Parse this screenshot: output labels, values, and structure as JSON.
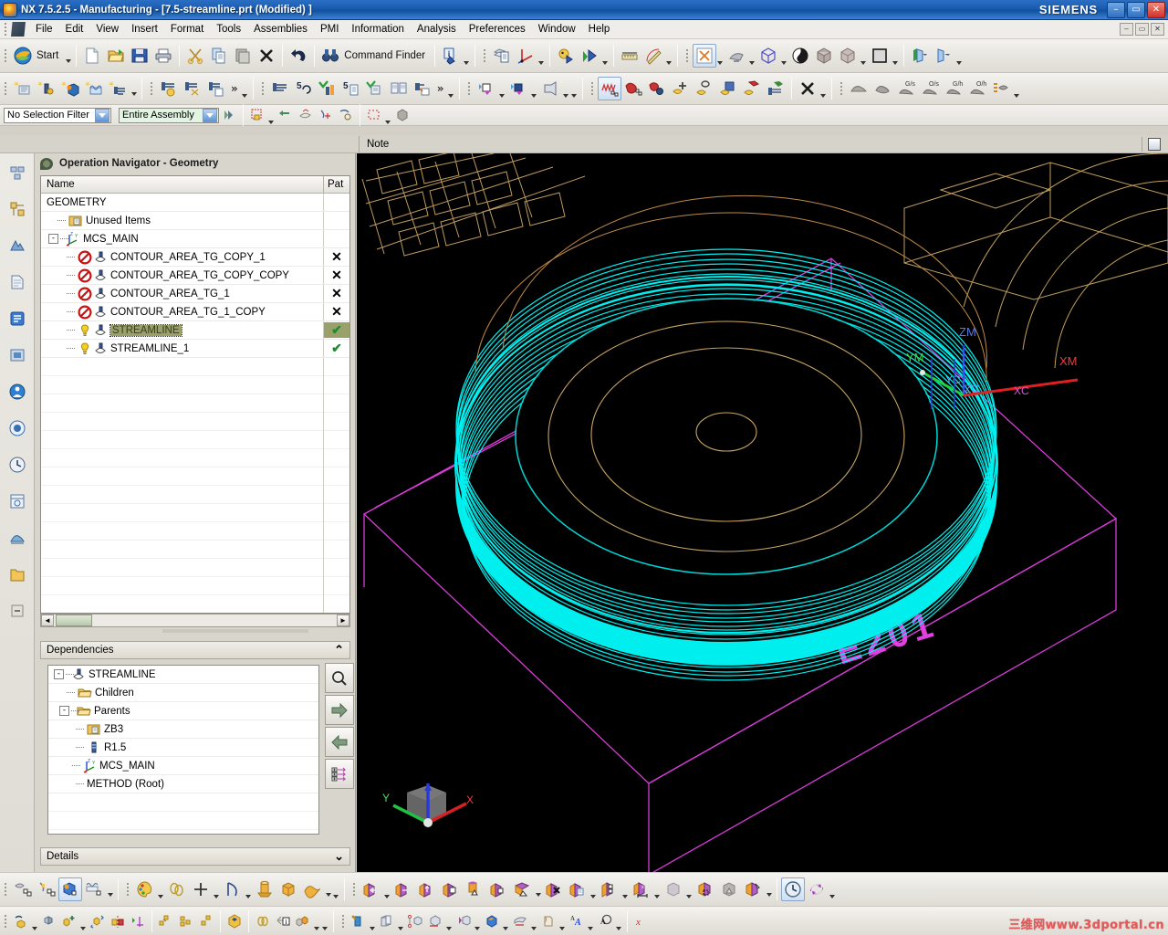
{
  "window": {
    "title": "NX 7.5.2.5 - Manufacturing - [7.5-streamline.prt (Modified) ]",
    "brand": "SIEMENS",
    "app_icon": "nx-logo-icon",
    "minimize": "–",
    "maximize": "▭",
    "close": "✕"
  },
  "menubar": {
    "items": [
      {
        "label": "File"
      },
      {
        "label": "Edit"
      },
      {
        "label": "View"
      },
      {
        "label": "Insert"
      },
      {
        "label": "Format"
      },
      {
        "label": "Tools"
      },
      {
        "label": "Assemblies"
      },
      {
        "label": "PMI"
      },
      {
        "label": "Information"
      },
      {
        "label": "Analysis"
      },
      {
        "label": "Preferences"
      },
      {
        "label": "Window"
      },
      {
        "label": "Help"
      }
    ],
    "doc_buttons": [
      "–",
      "▭",
      "✕"
    ]
  },
  "toolbar_standard": {
    "start_label": "Start",
    "command_finder_label": "Command Finder",
    "buttons": [
      {
        "name": "new-file-button",
        "icon": "new-document-icon"
      },
      {
        "name": "open-file-button",
        "icon": "open-folder-icon"
      },
      {
        "name": "save-button",
        "icon": "floppy-disk-icon"
      },
      {
        "name": "print-button",
        "icon": "printer-icon"
      },
      {
        "name": "cut-button",
        "icon": "scissors-icon"
      },
      {
        "name": "copy-button",
        "icon": "copy-icon"
      },
      {
        "name": "paste-button",
        "icon": "paste-icon"
      },
      {
        "name": "delete-button",
        "icon": "x-delete-icon"
      },
      {
        "name": "undo-button",
        "icon": "undo-arrow-icon"
      },
      {
        "name": "command-finder-button",
        "icon": "binoculars-icon"
      },
      {
        "name": "information-button",
        "icon": "info-badge-icon"
      },
      {
        "name": "layer-settings-button",
        "icon": "layers-icon"
      },
      {
        "name": "wcs-button",
        "icon": "wcs-axis-icon"
      },
      {
        "name": "move-object-button",
        "icon": "move-object-icon"
      },
      {
        "name": "show-hide-button",
        "icon": "show-hide-icon"
      },
      {
        "name": "measure-distance-button",
        "icon": "ruler-icon"
      },
      {
        "name": "measure-angle-button",
        "icon": "protractor-icon"
      },
      {
        "name": "fit-view-button",
        "icon": "fit-window-icon"
      },
      {
        "name": "zoom-button",
        "icon": "zoom-view-icon"
      },
      {
        "name": "orient-view-button",
        "icon": "iso-cube-icon"
      },
      {
        "name": "render-style-button",
        "icon": "shading-sphere-icon"
      },
      {
        "name": "shaded-button",
        "icon": "shaded-cube-icon"
      },
      {
        "name": "wireframe-button",
        "icon": "wire-cube-icon"
      },
      {
        "name": "background-color-button",
        "icon": "background-swatch-icon"
      },
      {
        "name": "section-view-button",
        "icon": "clip-section-icon"
      },
      {
        "name": "clip-plane-button",
        "icon": "clip-plane-icon"
      }
    ]
  },
  "toolbar_manufacturing": {
    "overflow_glyph": "»",
    "buttons": [
      {
        "name": "create-program-button",
        "icon": "create-program-icon"
      },
      {
        "name": "create-tool-button",
        "icon": "create-tool-icon"
      },
      {
        "name": "create-geometry-button",
        "icon": "create-geometry-icon"
      },
      {
        "name": "create-method-button",
        "icon": "create-method-icon"
      },
      {
        "name": "create-operation-button",
        "icon": "create-operation-icon"
      },
      {
        "name": "generate-toolpath-button",
        "icon": "generate-toolpath-icon"
      },
      {
        "name": "cut-toolpath-button",
        "icon": "cut-toolpath-icon"
      },
      {
        "name": "copy-toolpath-button",
        "icon": "copy-toolpath-icon"
      },
      {
        "name": "verify-toolpath-button",
        "icon": "verify-toolpath-icon"
      },
      {
        "name": "replay-toolpath-button",
        "icon": "replay-toolpath-icon"
      },
      {
        "name": "confirm-toolpath-button",
        "icon": "confirm-toolpath-icon"
      },
      {
        "name": "list-toolpath-button",
        "icon": "list-toolpath-icon"
      },
      {
        "name": "postprocess-button",
        "icon": "postprocess-icon"
      },
      {
        "name": "shop-documentation-button",
        "icon": "shop-doc-icon"
      },
      {
        "name": "output-cls-button",
        "icon": "output-cls-icon"
      },
      {
        "name": "mill-contour-button",
        "icon": "mill-contour-icon"
      },
      {
        "name": "mill-planar-button",
        "icon": "mill-planar-icon"
      },
      {
        "name": "drill-button",
        "icon": "drill-icon"
      },
      {
        "name": "turn-profile-button",
        "icon": "turn-profile-icon"
      },
      {
        "name": "tool-path-display-button",
        "icon": "toolpath-display-icon"
      },
      {
        "name": "simulate-button",
        "icon": "simulate-icon"
      },
      {
        "name": "analyze-toolpath-button",
        "icon": "analyze-toolpath-icon"
      },
      {
        "name": "create-feature-button",
        "icon": "create-feature-icon"
      },
      {
        "name": "hole-feature-button",
        "icon": "hole-feature-icon"
      },
      {
        "name": "pocket-feature-button",
        "icon": "pocket-feature-icon"
      },
      {
        "name": "boss-feature-button",
        "icon": "boss-feature-icon"
      },
      {
        "name": "machine-feature-button",
        "icon": "machine-feature-icon"
      },
      {
        "name": "remove-button",
        "icon": "x-remove-icon"
      },
      {
        "name": "ipw-in-process-button",
        "icon": "ipw-workpiece-icon"
      },
      {
        "name": "blank-workpiece-button",
        "icon": "blank-workpiece-icon"
      },
      {
        "name": "gouge-check-button",
        "icon": "gouge-check-icon",
        "badge": "G/s"
      },
      {
        "name": "overcut-check-button",
        "icon": "overcut-check-icon",
        "badge": "O/s"
      },
      {
        "name": "gouge-holder-button",
        "icon": "gouge-holder-icon",
        "badge": "G/h"
      },
      {
        "name": "overcut-holder-button",
        "icon": "overcut-holder-icon",
        "badge": "O/h"
      },
      {
        "name": "transfer-button",
        "icon": "transfer-icon"
      }
    ]
  },
  "selection_bar": {
    "filter": {
      "value": "No Selection Filter",
      "name": "selection-filter-combo"
    },
    "scope": {
      "value": "Entire Assembly",
      "name": "selection-scope-combo"
    },
    "buttons": [
      {
        "name": "select-general-objects-button",
        "icon": "select-objects-icon"
      },
      {
        "name": "snap-point-button",
        "icon": "snap-point-icon"
      },
      {
        "name": "back-button",
        "icon": "back-arrow-icon"
      },
      {
        "name": "face-select-button",
        "icon": "face-select-icon"
      },
      {
        "name": "point-on-curve-button",
        "icon": "point-curve-icon"
      },
      {
        "name": "quadrant-point-button",
        "icon": "quadrant-point-icon"
      },
      {
        "name": "rectangle-select-button",
        "icon": "rectangle-select-icon"
      },
      {
        "name": "solid-body-button",
        "icon": "solid-body-icon"
      }
    ]
  },
  "cue_bar": {
    "note": "Note",
    "status_icon": "window-status-icon"
  },
  "resource_bar": {
    "items": [
      {
        "name": "resource-assembly-navigator",
        "icon": "assembly-navigator-icon"
      },
      {
        "name": "resource-constraint-navigator",
        "icon": "constraint-navigator-icon"
      },
      {
        "name": "resource-part-navigator",
        "icon": "part-navigator-icon"
      },
      {
        "name": "resource-reuse-library",
        "icon": "reuse-library-icon"
      },
      {
        "name": "resource-operation-navigator",
        "icon": "operation-navigator-icon"
      },
      {
        "name": "resource-machine-tool-navigator",
        "icon": "machine-tool-navigator-icon"
      },
      {
        "name": "resource-roles",
        "icon": "roles-icon"
      },
      {
        "name": "resource-system-materials",
        "icon": "system-materials-icon"
      },
      {
        "name": "resource-history",
        "icon": "history-clock-icon"
      },
      {
        "name": "resource-web-browser",
        "icon": "web-browser-icon"
      },
      {
        "name": "resource-hd3d-tools",
        "icon": "hd3d-tools-icon"
      },
      {
        "name": "resource-processes",
        "icon": "processes-icon"
      },
      {
        "name": "resource-manufacturing-wizards",
        "icon": "manufacturing-wizards-icon"
      },
      {
        "name": "resource-folder",
        "icon": "folder-icon"
      },
      {
        "name": "resource-more",
        "icon": "more-icon"
      }
    ]
  },
  "navigator": {
    "title": "Operation Navigator - Geometry",
    "title_icon": "operation-navigator-icon",
    "columns": [
      "Name",
      "Pat"
    ],
    "rows": [
      {
        "label": "GEOMETRY",
        "depth": 0,
        "icon": "none",
        "expander": "",
        "mark": "",
        "selected": false
      },
      {
        "label": "Unused Items",
        "depth": 1,
        "icon": "unused-items-icon",
        "expander": "",
        "mark": "",
        "selected": false
      },
      {
        "label": "MCS_MAIN",
        "depth": 1,
        "icon": "mcs-icon",
        "expander": "-",
        "mark": "",
        "selected": false
      },
      {
        "label": "CONTOUR_AREA_TG_COPY_1",
        "depth": 2,
        "icon": "operation-blocked-icon",
        "expander": "",
        "mark": "x",
        "selected": false
      },
      {
        "label": "CONTOUR_AREA_TG_COPY_COPY",
        "depth": 2,
        "icon": "operation-blocked-icon",
        "expander": "",
        "mark": "x",
        "selected": false
      },
      {
        "label": "CONTOUR_AREA_TG_1",
        "depth": 2,
        "icon": "operation-blocked-icon",
        "expander": "",
        "mark": "x",
        "selected": false
      },
      {
        "label": "CONTOUR_AREA_TG_1_COPY",
        "depth": 2,
        "icon": "operation-blocked-icon",
        "expander": "",
        "mark": "x",
        "selected": false
      },
      {
        "label": "STREAMLINE",
        "depth": 2,
        "icon": "operation-warning-icon",
        "expander": "",
        "mark": "check",
        "selected": true
      },
      {
        "label": "STREAMLINE_1",
        "depth": 2,
        "icon": "operation-warning-icon",
        "expander": "",
        "mark": "check",
        "selected": false
      }
    ],
    "scroll": {
      "left_arrow": "◄",
      "right_arrow": "►"
    }
  },
  "dependencies": {
    "title": "Dependencies",
    "collapse_glyph": "⌃",
    "rows": [
      {
        "label": "STREAMLINE",
        "depth": 0,
        "icon": "operation-icon",
        "expander": "-"
      },
      {
        "label": "Children",
        "depth": 1,
        "icon": "folder-icon",
        "expander": ""
      },
      {
        "label": "Parents",
        "depth": 1,
        "icon": "folder-icon",
        "expander": "-"
      },
      {
        "label": "ZB3",
        "depth": 2,
        "icon": "program-group-icon",
        "expander": ""
      },
      {
        "label": "R1.5",
        "depth": 2,
        "icon": "tool-icon",
        "expander": ""
      },
      {
        "label": "MCS_MAIN",
        "depth": 2,
        "icon": "mcs-icon",
        "expander": ""
      },
      {
        "label": "METHOD (Root)",
        "depth": 2,
        "icon": "none",
        "expander": ""
      }
    ],
    "side_buttons": [
      {
        "name": "dependency-find-button",
        "icon": "magnifier-icon"
      },
      {
        "name": "dependency-forward-button",
        "icon": "arrow-right-icon"
      },
      {
        "name": "dependency-back-button",
        "icon": "arrow-left-icon"
      },
      {
        "name": "dependency-expand-all-button",
        "icon": "expand-all-icon"
      }
    ]
  },
  "details": {
    "title": "Details",
    "expand_glyph": "⌄"
  },
  "viewport": {
    "part_label": "E201",
    "wcs_labels": [
      "ZM",
      "YM",
      "XM"
    ],
    "csys_labels": [
      "ZC",
      "YC",
      "XC"
    ],
    "triad_labels": [
      "X",
      "Y",
      "Z"
    ],
    "colors": {
      "toolpath_cyan": "#00f0f0",
      "blank_magenta": "#e040e0",
      "part_tan": "#c8b070",
      "wcs_blue": "#3a4ff0",
      "axis_red": "#e02020",
      "axis_green": "#20d040",
      "background": "#000000"
    }
  },
  "toolbar_bottom_view": {
    "buttons": [
      {
        "name": "edit-object-display-button",
        "icon": "edit-display-icon"
      },
      {
        "name": "edit-section-button",
        "icon": "edit-section-icon"
      },
      {
        "name": "shaded-render-button",
        "icon": "shaded-render-icon",
        "active": true
      },
      {
        "name": "edit-background-button",
        "icon": "edit-background-icon"
      },
      {
        "name": "color-palette-button",
        "icon": "color-palette-icon"
      },
      {
        "name": "curve-chain-button",
        "icon": "chain-curve-icon"
      },
      {
        "name": "point-button",
        "icon": "plus-point-icon"
      },
      {
        "name": "arc-button",
        "icon": "arc-curve-icon"
      },
      {
        "name": "extrude-button",
        "icon": "extrude-cylinder-icon"
      },
      {
        "name": "block-button",
        "icon": "block-solid-icon"
      },
      {
        "name": "sweep-button",
        "icon": "sweep-solid-icon"
      },
      {
        "name": "move-face-button",
        "icon": "move-face-icon"
      },
      {
        "name": "resize-face-button",
        "icon": "resize-face-icon"
      },
      {
        "name": "offset-face-button",
        "icon": "offset-face-icon"
      },
      {
        "name": "copy-face-button",
        "icon": "copy-face-icon"
      },
      {
        "name": "taper-face-button",
        "icon": "taper-face-icon"
      },
      {
        "name": "replace-face-button",
        "icon": "replace-face-icon"
      },
      {
        "name": "cut-face-button",
        "icon": "cut-face-icon"
      },
      {
        "name": "delete-face-button",
        "icon": "delete-face-icon"
      },
      {
        "name": "paste-face-button",
        "icon": "paste-face-icon"
      },
      {
        "name": "split-face-button",
        "icon": "split-face-icon"
      },
      {
        "name": "dimension-face-button",
        "icon": "dimension-face-icon"
      },
      {
        "name": "transparent-solid-button",
        "icon": "transparent-solid-icon"
      },
      {
        "name": "body-region-button",
        "icon": "body-region-icon"
      },
      {
        "name": "hidden-body-button",
        "icon": "hidden-body-icon"
      },
      {
        "name": "heal-geometry-button",
        "icon": "heal-geometry-icon"
      },
      {
        "name": "history-clock-button",
        "icon": "history-clock-icon",
        "active": true
      },
      {
        "name": "update-model-button",
        "icon": "update-refresh-icon"
      }
    ]
  },
  "toolbar_bottom_assembly": {
    "buttons": [
      {
        "name": "assembly-constraints-button",
        "icon": "assembly-constraints-icon"
      },
      {
        "name": "exploded-view-button",
        "icon": "exploded-view-icon"
      },
      {
        "name": "add-component-button",
        "icon": "add-component-icon"
      },
      {
        "name": "move-component-button",
        "icon": "move-component-icon"
      },
      {
        "name": "mirror-assembly-button",
        "icon": "mirror-assembly-icon"
      },
      {
        "name": "arrange-button",
        "icon": "arrange-icon"
      },
      {
        "name": "wave-geometry-linker-button",
        "icon": "wave-linker-icon"
      },
      {
        "name": "component-array-button",
        "icon": "component-array-icon"
      },
      {
        "name": "pattern-component-button",
        "icon": "pattern-component-icon"
      },
      {
        "name": "sectioning-button",
        "icon": "sectioning-icon"
      },
      {
        "name": "chain-button",
        "icon": "chain-icon"
      },
      {
        "name": "assembly-report-button",
        "icon": "assembly-report-icon"
      },
      {
        "name": "component-color-button",
        "icon": "component-color-icon"
      },
      {
        "name": "sketch-button",
        "icon": "sketch-icon"
      },
      {
        "name": "extrude-solid-button",
        "icon": "extrude-solid-icon"
      },
      {
        "name": "rib-button",
        "icon": "rib-icon"
      },
      {
        "name": "datum-point-button",
        "icon": "datum-point-icon"
      },
      {
        "name": "datum-plane-button",
        "icon": "datum-plane-icon"
      },
      {
        "name": "mirror-feature-button",
        "icon": "mirror-feature-icon"
      },
      {
        "name": "shell-button",
        "icon": "shell-icon"
      },
      {
        "name": "edge-blend-button",
        "icon": "edge-blend-icon"
      },
      {
        "name": "trim-body-button",
        "icon": "trim-body-icon"
      },
      {
        "name": "annotation-text-button",
        "icon": "annotation-text-icon"
      },
      {
        "name": "note-button",
        "icon": "note-balloon-icon"
      },
      {
        "name": "expression-button",
        "icon": "expression-icon"
      }
    ]
  },
  "watermark": {
    "text": "三维网www.3dportal.cn",
    "color": "#e05a5a"
  }
}
